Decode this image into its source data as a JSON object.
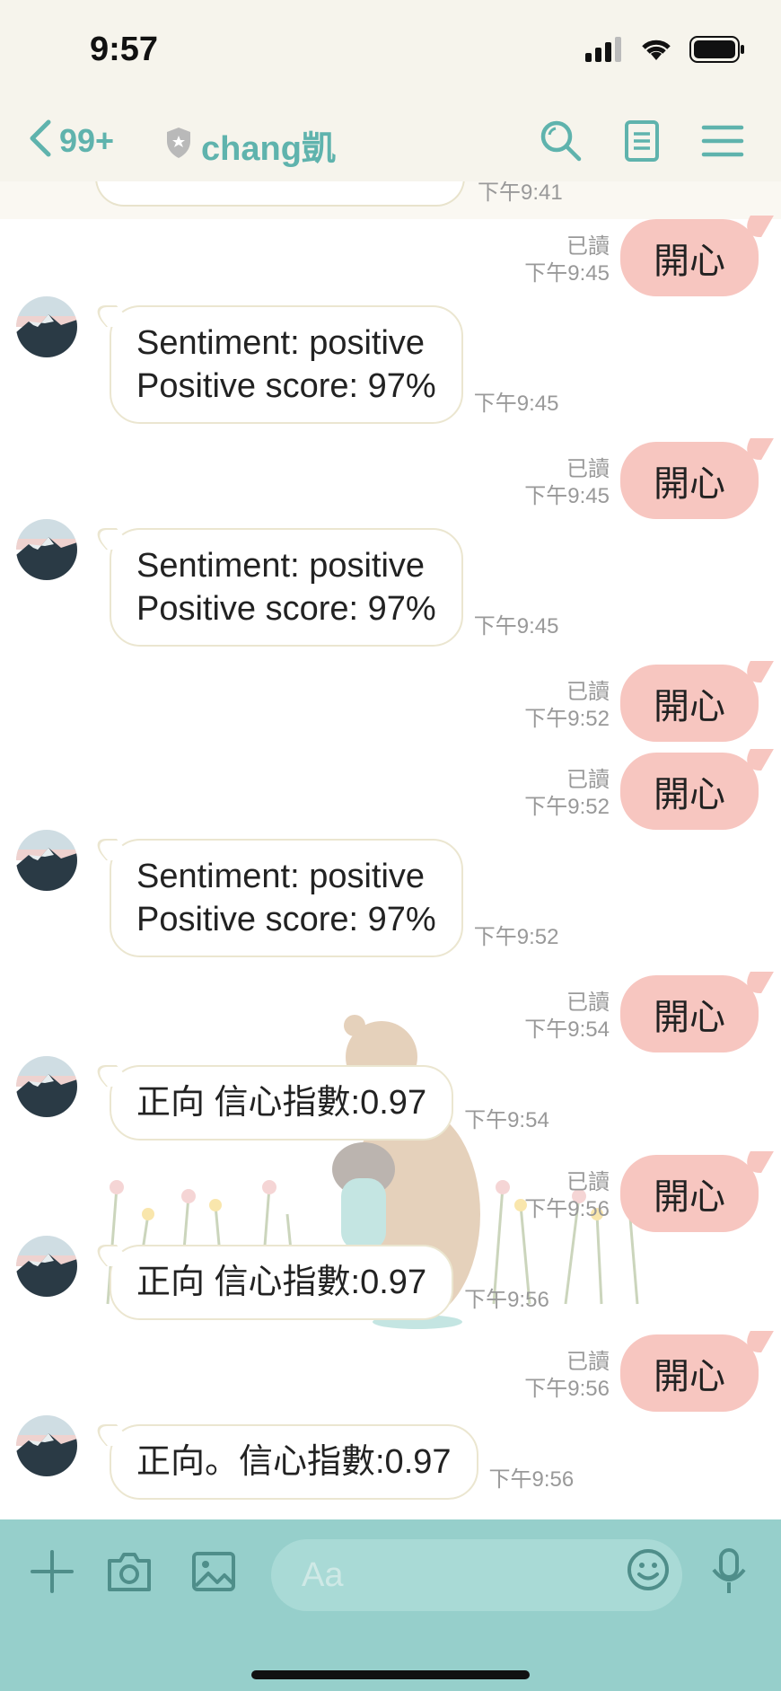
{
  "status_bar": {
    "time": "9:57"
  },
  "header": {
    "back_count": "99+",
    "title": "chang凱"
  },
  "partial_message": {
    "time": "下午9:41"
  },
  "messages": [
    {
      "dir": "out",
      "read": "已讀",
      "time": "下午9:45",
      "text": "開心"
    },
    {
      "dir": "in",
      "line1": "Sentiment: positive",
      "line2": "Positive score: 97%",
      "time": "下午9:45"
    },
    {
      "dir": "out",
      "read": "已讀",
      "time": "下午9:45",
      "text": "開心"
    },
    {
      "dir": "in",
      "line1": "Sentiment: positive",
      "line2": "Positive score: 97%",
      "time": "下午9:45"
    },
    {
      "dir": "out",
      "read": "已讀",
      "time": "下午9:52",
      "text": "開心"
    },
    {
      "dir": "out",
      "read": "已讀",
      "time": "下午9:52",
      "text": "開心"
    },
    {
      "dir": "in",
      "line1": "Sentiment: positive",
      "line2": "Positive score: 97%",
      "time": "下午9:52"
    },
    {
      "dir": "out",
      "read": "已讀",
      "time": "下午9:54",
      "text": "開心"
    },
    {
      "dir": "in",
      "line1": "正向 信心指數:0.97",
      "time": "下午9:54"
    },
    {
      "dir": "out",
      "read": "已讀",
      "time": "下午9:56",
      "text": "開心"
    },
    {
      "dir": "in",
      "line1": "正向 信心指數:0.97",
      "time": "下午9:56"
    },
    {
      "dir": "out",
      "read": "已讀",
      "time": "下午9:56",
      "text": "開心"
    },
    {
      "dir": "in",
      "line1": "正向。信心指數:0.97",
      "time": "下午9:56"
    }
  ],
  "input": {
    "placeholder": "Aa"
  },
  "colors": {
    "accent": "#5fb3ad",
    "out_bubble": "#f7c6c0",
    "input_bar": "#96cfcb"
  }
}
